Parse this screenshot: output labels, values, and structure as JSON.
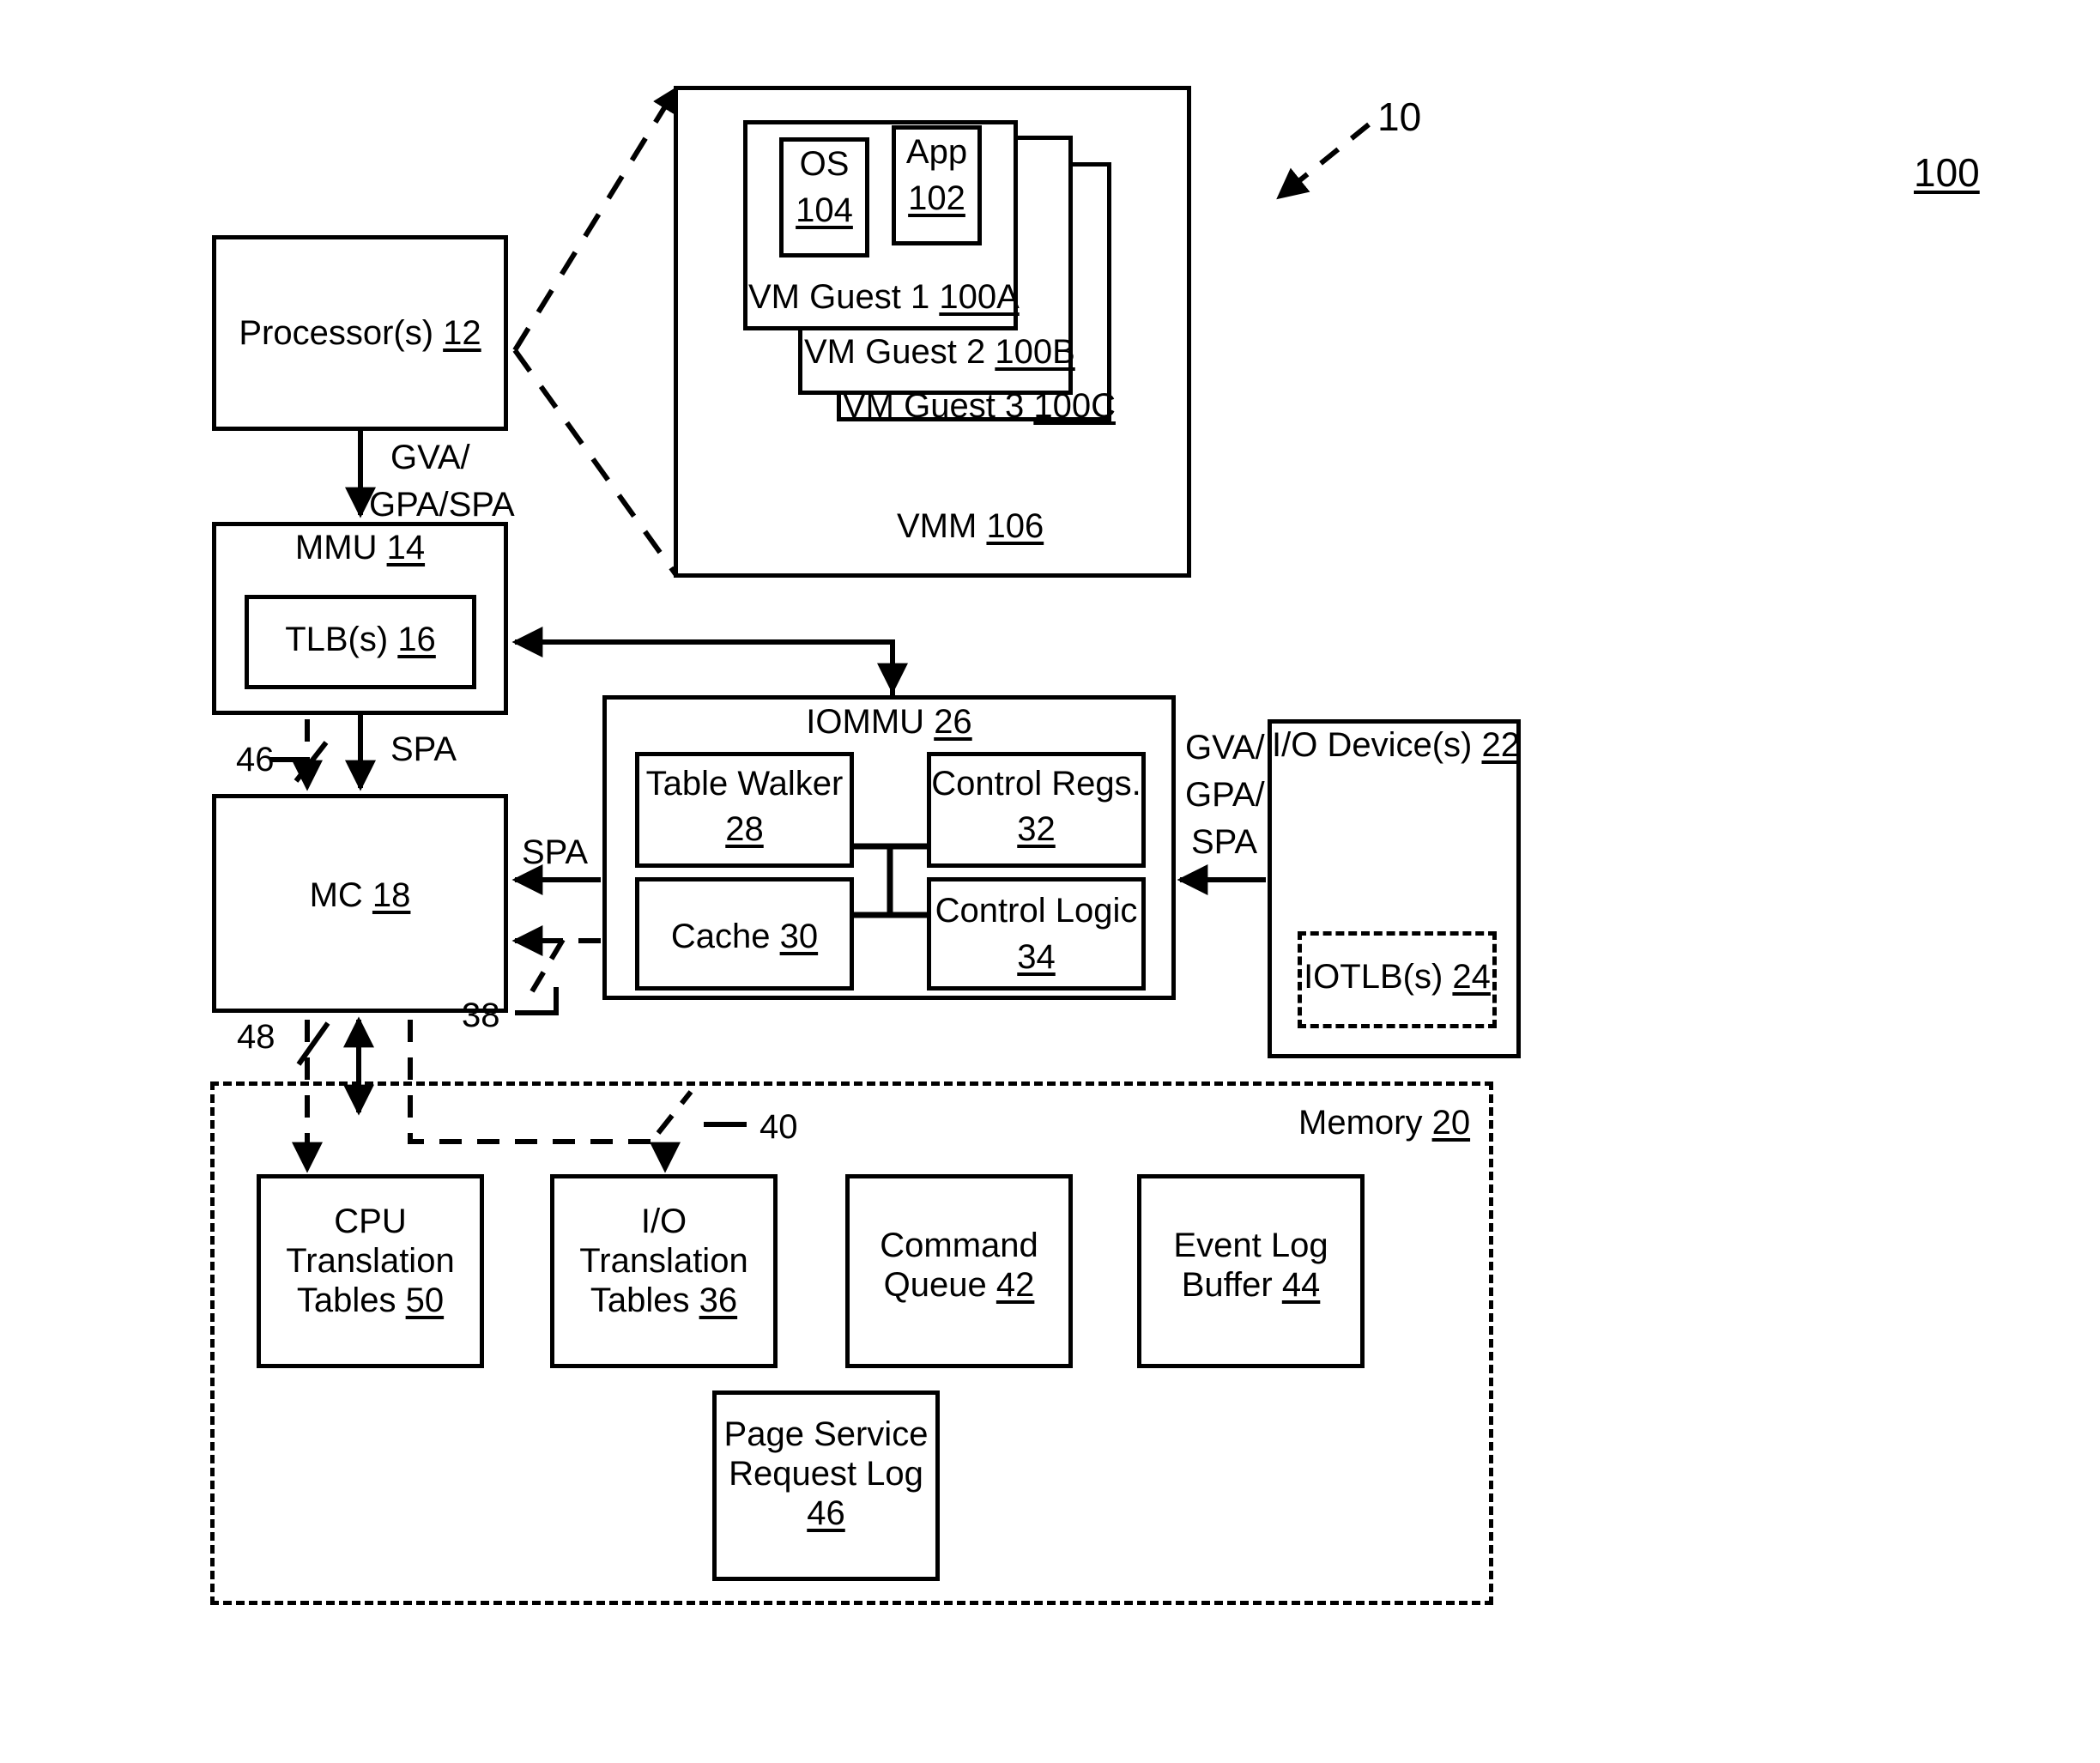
{
  "figure": {
    "figure_ref_label": "100",
    "system_ref_label": "10"
  },
  "vmm_panel": {
    "vmm_label": "VMM",
    "vmm_ref": "106",
    "guests": [
      {
        "label": "VM Guest 1",
        "ref": "100A"
      },
      {
        "label": "VM Guest 2",
        "ref": "100B"
      },
      {
        "label": "VM Guest 3",
        "ref": "100C"
      }
    ],
    "os": {
      "label": "OS",
      "ref": "104"
    },
    "app": {
      "label": "App",
      "ref": "102"
    }
  },
  "blocks": {
    "processor": {
      "label": "Processor(s)",
      "ref": "12"
    },
    "mmu": {
      "label": "MMU",
      "ref": "14"
    },
    "tlb": {
      "label": "TLB(s)",
      "ref": "16"
    },
    "mc": {
      "label": "MC",
      "ref": "18"
    },
    "iommu": {
      "label": "IOMMU",
      "ref": "26"
    },
    "table_walker": {
      "label": "Table Walker",
      "ref": "28"
    },
    "cache": {
      "label": "Cache",
      "ref": "30"
    },
    "control_regs": {
      "label": "Control Regs.",
      "ref": "32"
    },
    "control_logic": {
      "label": "Control Logic",
      "ref": "34"
    },
    "io_devices": {
      "label": "I/O Device(s)",
      "ref": "22"
    },
    "iotlb": {
      "label": "IOTLB(s)",
      "ref": "24"
    },
    "memory": {
      "label": "Memory",
      "ref": "20"
    },
    "cpu_translation_tables": {
      "line1": "CPU",
      "line2": "Translation",
      "line3": "Tables",
      "ref": "50"
    },
    "io_translation_tables": {
      "line1": "I/O",
      "line2": "Translation",
      "line3": "Tables",
      "ref": "36"
    },
    "command_queue": {
      "line1": "Command",
      "line2": "Queue",
      "ref": "42"
    },
    "event_log_buffer": {
      "line1": "Event Log",
      "line2": "Buffer",
      "ref": "44"
    },
    "page_service_request_log": {
      "line1": "Page Service",
      "line2": "Request Log",
      "ref": "46"
    }
  },
  "edge_labels": {
    "proc_to_mmu_line1": "GVA/",
    "proc_to_mmu_line2": "GPA/SPA",
    "mmu_to_mc_spa": "SPA",
    "iommu_to_mc_spa": "SPA",
    "io_to_iommu_line1": "GVA/",
    "io_to_iommu_line2": "GPA/",
    "io_to_iommu_line3": "SPA",
    "ref_46": "46",
    "ref_48": "48",
    "ref_38": "38",
    "ref_40": "40"
  }
}
